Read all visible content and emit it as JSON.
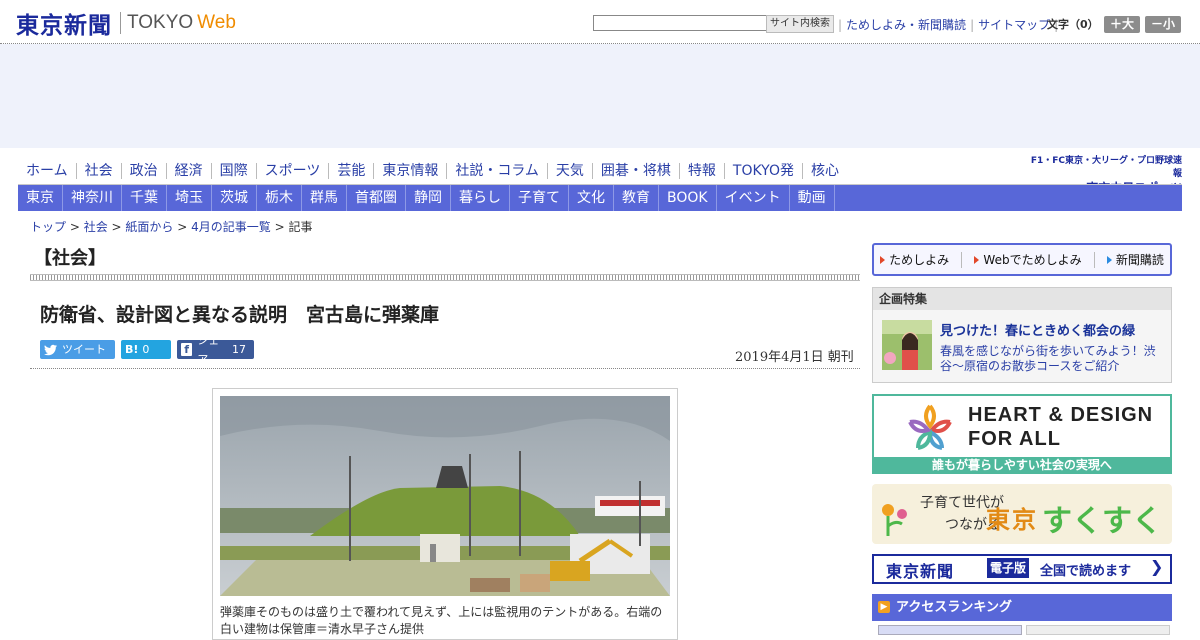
{
  "header": {
    "logo_jp": "東京新聞",
    "logo_en": "TOKYO",
    "logo_web": "Web",
    "search_placeholder": "",
    "search_button": "サイト内検索",
    "links": [
      "ためしよみ・新聞購読",
      "サイトマップ"
    ],
    "font_size_label": "文字（0）",
    "font_large": "＋大",
    "font_small": "－小"
  },
  "nav_main": [
    "ホーム",
    "社会",
    "政治",
    "経済",
    "国際",
    "スポーツ",
    "芸能",
    "東京情報",
    "社説・コラム",
    "天気",
    "囲碁・将棋",
    "特報",
    "TOKYO発",
    "核心"
  ],
  "sports_banner": {
    "top": "F1・FC東京・大リーグ・プロ野球速報",
    "bottom": "東京中日スポーツ"
  },
  "nav_sub": [
    "東京",
    "神奈川",
    "千葉",
    "埼玉",
    "茨城",
    "栃木",
    "群馬",
    "首都圏",
    "静岡",
    "暮らし",
    "子育て",
    "文化",
    "教育",
    "BOOK",
    "イベント",
    "動画"
  ],
  "breadcrumb": {
    "items": [
      "トップ",
      "社会",
      "紙面から",
      "4月の記事一覧"
    ],
    "current": "記事",
    "sep": " > "
  },
  "article": {
    "section": "【社会】",
    "headline": "防衛省、設計図と異なる説明　宮古島に弾薬庫",
    "date": "2019年4月1日 朝刊",
    "caption": "弾薬庫そのものは盛り土で覆われて見えず、上には監視用のテントがある。右端の白い建物は保管庫＝清水早子さん提供"
  },
  "share": {
    "tweet": "ツイート",
    "hatena_icon": "B!",
    "hatena_count": "0",
    "facebook_label": "シェア",
    "facebook_count": "17"
  },
  "right": {
    "buttons": [
      "ためしよみ",
      "Webでためしよみ",
      "新聞購読"
    ],
    "feature_head": "企画特集",
    "feature_title": "見つけた！春にときめく都会の緑",
    "feature_desc": "春風を感じながら街を歩いてみよう！渋谷～原宿のお散歩コースをご紹介",
    "heart_title1": "HEART & DESIGN",
    "heart_title2": "FOR ALL",
    "heart_foot": "誰もが暮らしやすい社会の実現へ",
    "suku_l1": "子育て世代が",
    "suku_l2": "つながる",
    "suku_tokyo": "東京",
    "suku_suku": "すくすく",
    "ebook_name": "東京新聞",
    "ebook_tag": "電子版",
    "ebook_text": "全国で読めます",
    "ranking_head": "アクセスランキング"
  },
  "colors": {
    "nav_sub": "#5867d8",
    "logo": "#1b2a9c",
    "accent_orange": "#f08c00"
  }
}
